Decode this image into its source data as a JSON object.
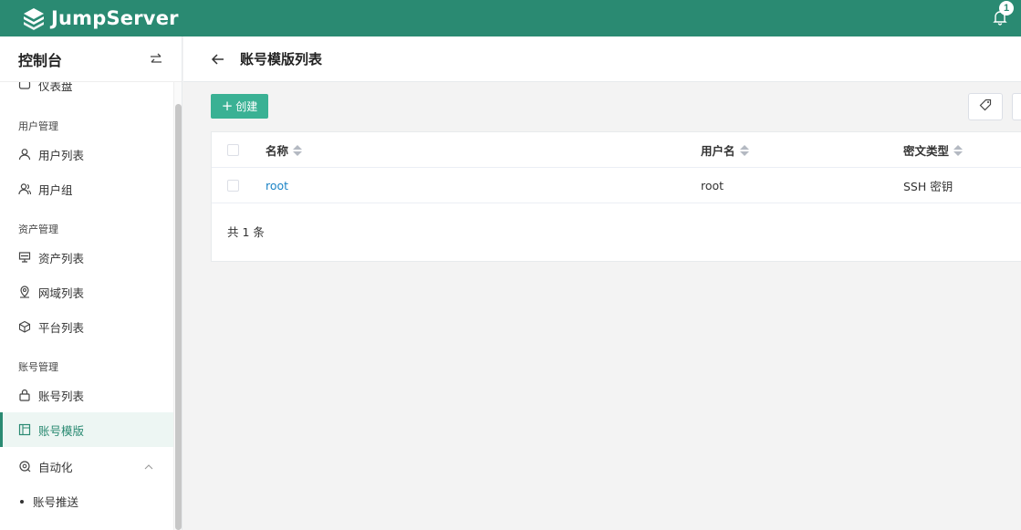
{
  "app": {
    "brand": "JumpServer",
    "notification_count": "1"
  },
  "sidebar": {
    "title": "控制台",
    "partial_top_item": "仪表盘",
    "groups": [
      {
        "label": "用户管理",
        "items": [
          "用户列表",
          "用户组"
        ]
      },
      {
        "label": "资产管理",
        "items": [
          "资产列表",
          "网域列表",
          "平台列表"
        ]
      },
      {
        "label": "账号管理",
        "items": [
          "账号列表",
          "账号模版"
        ]
      }
    ],
    "active_item": "账号模版",
    "expandable": {
      "label": "自动化",
      "children": [
        "账号推送"
      ]
    }
  },
  "page": {
    "title": "账号模版列表"
  },
  "toolbar": {
    "create_label": "创建"
  },
  "table": {
    "columns": [
      "名称",
      "用户名",
      "密文类型"
    ],
    "rows": [
      {
        "name": "root",
        "username": "root",
        "secret_type": "SSH 密钥"
      }
    ],
    "total": "共 1 条"
  },
  "colors": {
    "brand": "#2a8a72",
    "accent": "#3ab194",
    "link": "#1c84c6"
  },
  "icons": [
    "logo-icon",
    "bell-icon",
    "switch-icon",
    "back-arrow-icon",
    "tag-icon",
    "user-icon",
    "users-icon",
    "server-icon",
    "location-icon",
    "cube-icon",
    "lock-icon",
    "template-icon",
    "automation-icon",
    "chevron-up-icon"
  ]
}
